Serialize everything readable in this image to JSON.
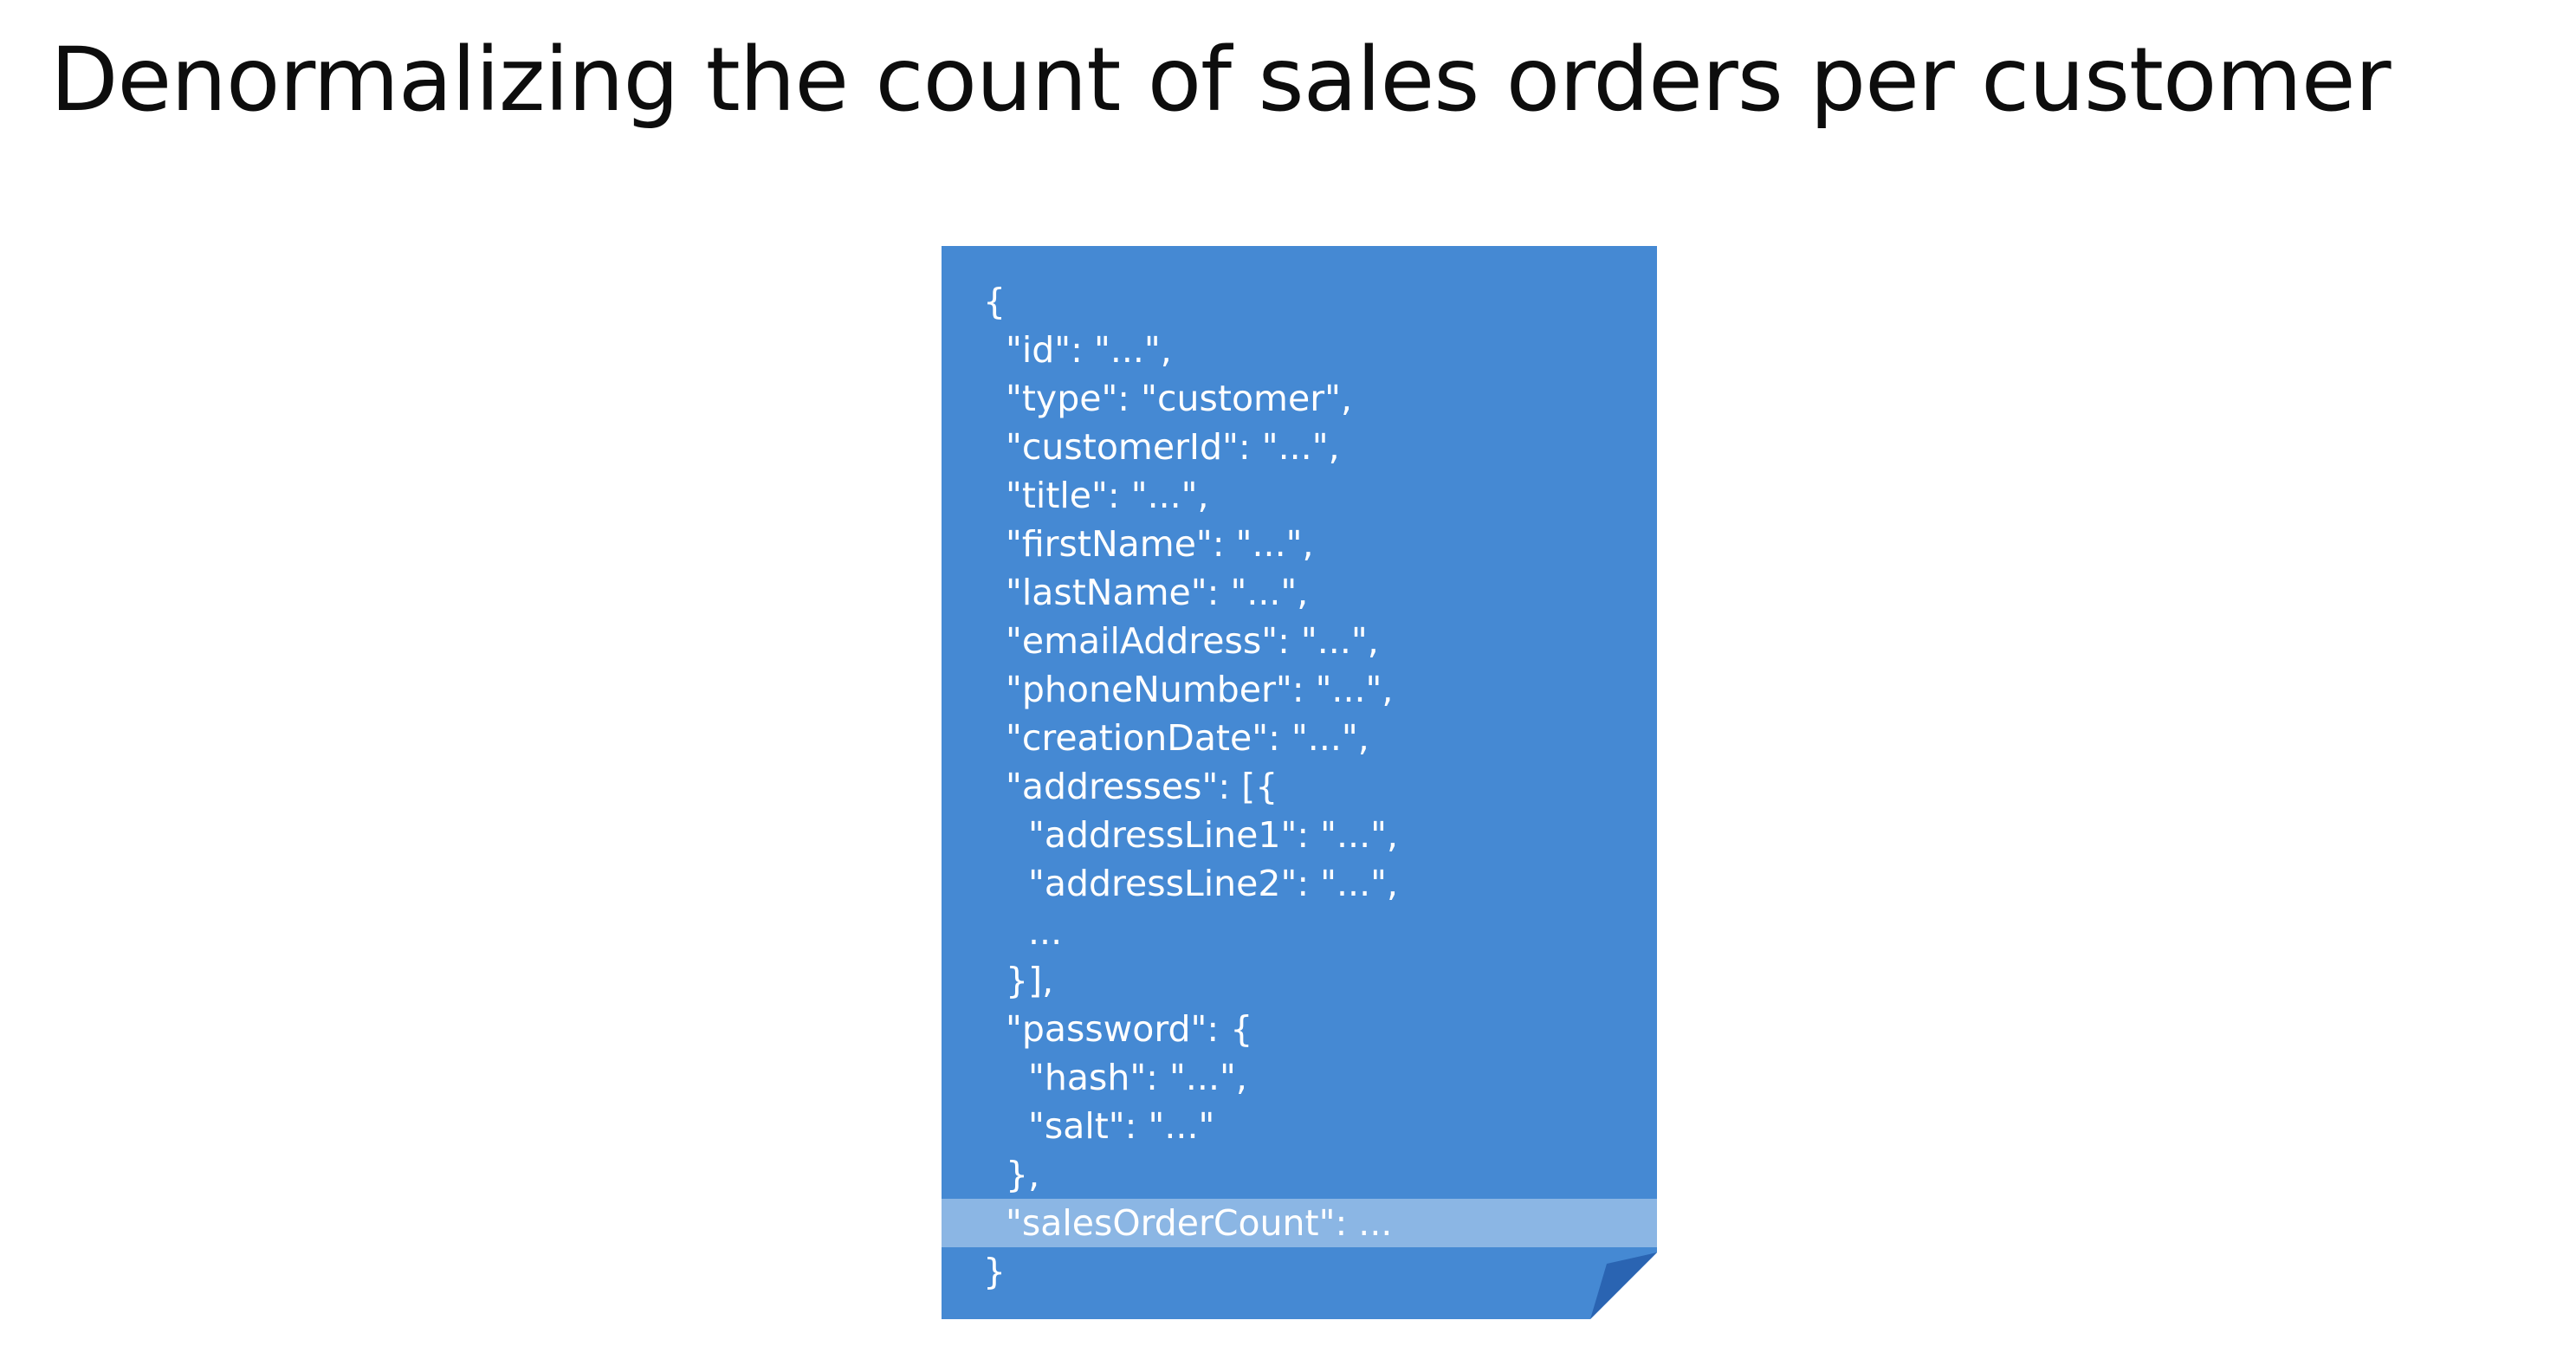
{
  "title": "Denormalizing the count of sales orders per customer",
  "colors": {
    "document_fill": "#4589d3",
    "document_fold": "#2a64b2",
    "highlight": "#8fbbe6",
    "text": "#ffffff"
  },
  "document": {
    "lines": [
      "{",
      "\"id\": \"...\",",
      "\"type\": \"customer\",",
      "\"customerId\": \"...\",",
      "\"title\": \"...\",",
      "\"firstName\": \"...\",",
      "\"lastName\": \"...\",",
      "\"emailAddress\": \"...\",",
      "\"phoneNumber\": \"...\",",
      "\"creationDate\": \"...\",",
      "\"addresses\": [{",
      "\"addressLine1\": \"...\",",
      "\"addressLine2\": \"...\",",
      "...",
      "}],",
      "\"password\": {",
      "\"hash\": \"...\",",
      "\"salt\": \"...\"",
      "},",
      "\"salesOrderCount\": ...",
      "}"
    ]
  }
}
